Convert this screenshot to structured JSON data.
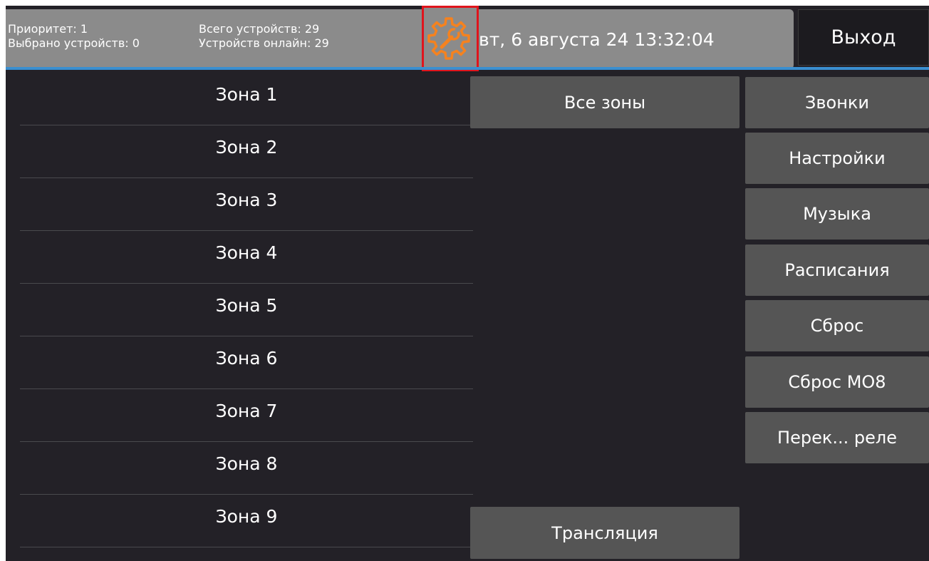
{
  "header": {
    "priority": "Приоритет: 1",
    "selected": "Выбрано устройств: 0",
    "total": "Всего устройств: 29",
    "online": "Устройств онлайн: 29",
    "datetime": "вт, 6 августа 24 13:32:04",
    "exit_label": "Выход",
    "settings_icon": "gear-wrench-icon"
  },
  "zones": [
    "Зона 1",
    "Зона 2",
    "Зона 3",
    "Зона 4",
    "Зона 5",
    "Зона 6",
    "Зона 7",
    "Зона 8",
    "Зона 9"
  ],
  "center": {
    "all_zones": "Все зоны",
    "broadcast": "Трансляция"
  },
  "side_menu": [
    "Звонки",
    "Настройки",
    "Музыка",
    "Расписания",
    "Сброс",
    "Сброс МО8",
    "Перек... реле"
  ],
  "colors": {
    "background": "#232127",
    "header": "#8b8b8b",
    "button": "#555555",
    "accent_line": "#3a8fd0",
    "icon": "#f5821f",
    "highlight": "#e0141c"
  }
}
